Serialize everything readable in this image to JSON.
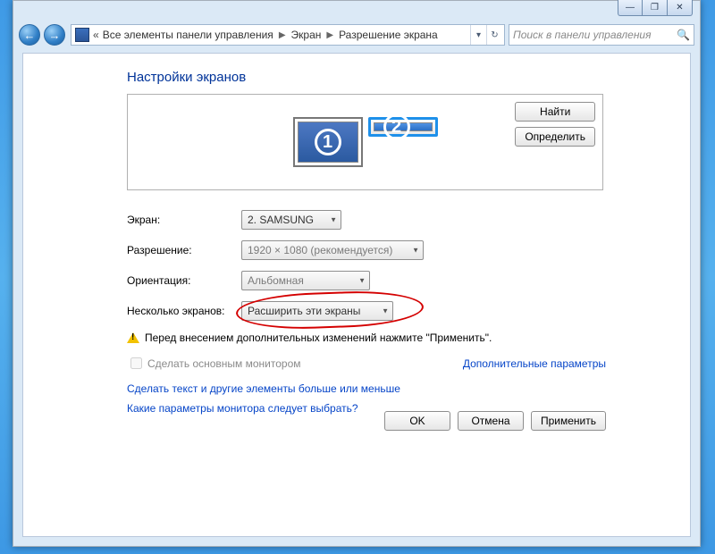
{
  "caption": {
    "min": "—",
    "max": "❐",
    "close": "✕"
  },
  "nav": {
    "back": "←",
    "fwd": "→"
  },
  "breadcrumbs": {
    "lead": "«",
    "a": "Все элементы панели управления",
    "b": "Экран",
    "c": "Разрешение экрана"
  },
  "search": {
    "placeholder": "Поиск в панели управления"
  },
  "heading": "Настройки экранов",
  "monitors": {
    "n1": "1",
    "n2": "2"
  },
  "sidebtn": {
    "find": "Найти",
    "detect": "Определить"
  },
  "labels": {
    "screen": "Экран:",
    "resolution": "Разрешение:",
    "orientation": "Ориентация:",
    "multi": "Несколько экранов:"
  },
  "values": {
    "screen": "2. SAMSUNG",
    "resolution": "1920 × 1080 (рекомендуется)",
    "orientation": "Альбомная",
    "multi": "Расширить эти экраны"
  },
  "warning": "Перед внесением дополнительных изменений нажмите \"Применить\".",
  "checkbox": "Сделать основным монитором",
  "advanced": "Дополнительные параметры",
  "link1": "Сделать текст и другие элементы больше или меньше",
  "link2": "Какие параметры монитора следует выбрать?",
  "buttons": {
    "ok": "OK",
    "cancel": "Отмена",
    "apply": "Применить"
  }
}
